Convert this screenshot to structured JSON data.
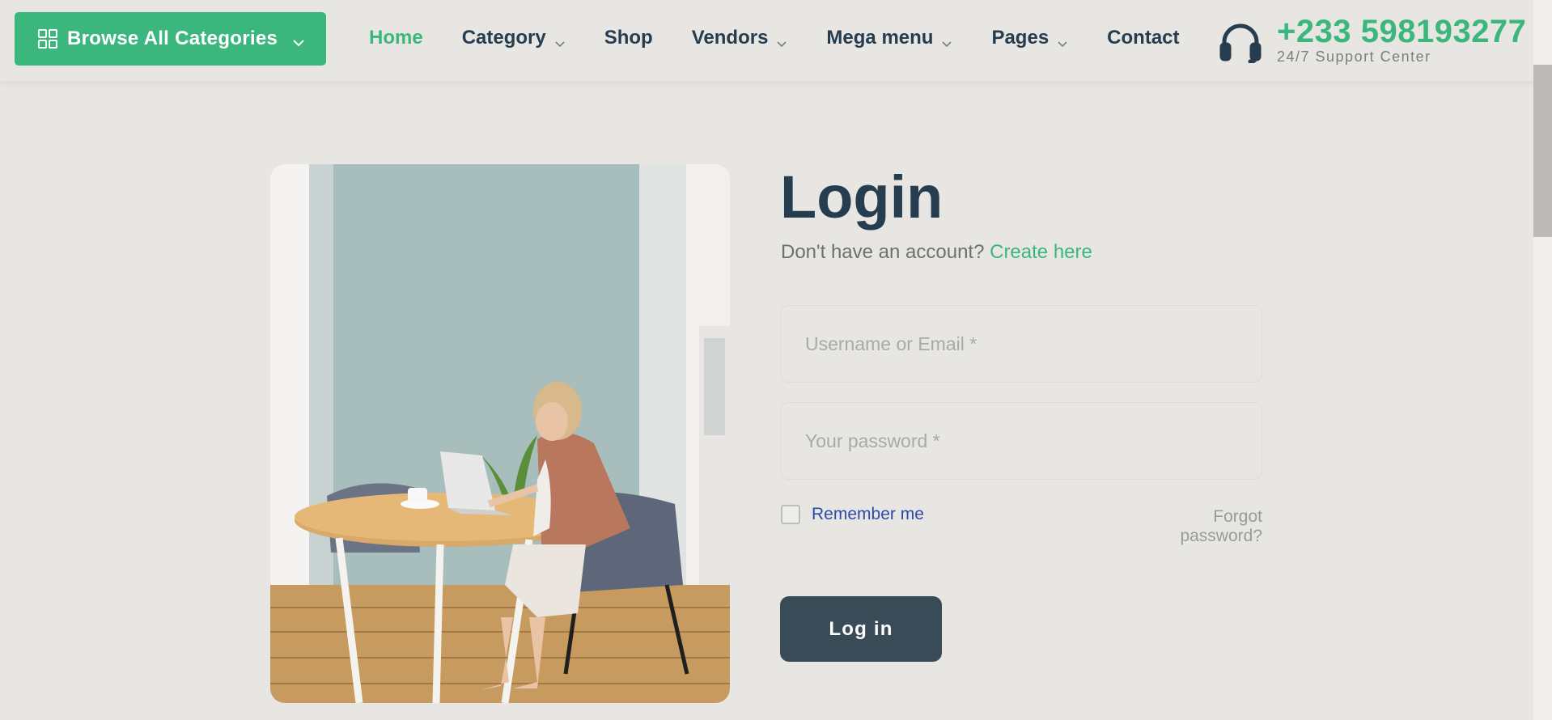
{
  "header": {
    "browse_label": "Browse All Categories",
    "nav": [
      {
        "label": "Home",
        "active": true
      },
      {
        "label": "Category"
      },
      {
        "label": "Shop"
      },
      {
        "label": "Vendors"
      },
      {
        "label": "Mega menu"
      },
      {
        "label": "Pages"
      },
      {
        "label": "Contact"
      }
    ],
    "support": {
      "phone": "+233 598193277",
      "subtitle": "24/7 Support Center"
    }
  },
  "login": {
    "title": "Login",
    "prompt": "Don't have an account?",
    "create_link": "Create here",
    "username_placeholder": "Username or Email *",
    "password_placeholder": "Your password *",
    "remember_label": "Remember me",
    "forgot_label": "Forgot password?",
    "submit_label": "Log in"
  },
  "colors": {
    "brand": "#3bb77e",
    "heading": "#253d4e",
    "button_dark": "#3a4b58"
  },
  "icons": {
    "browse": "grid-icon",
    "dropdown": "chevron-down-icon",
    "support": "headset-icon"
  }
}
